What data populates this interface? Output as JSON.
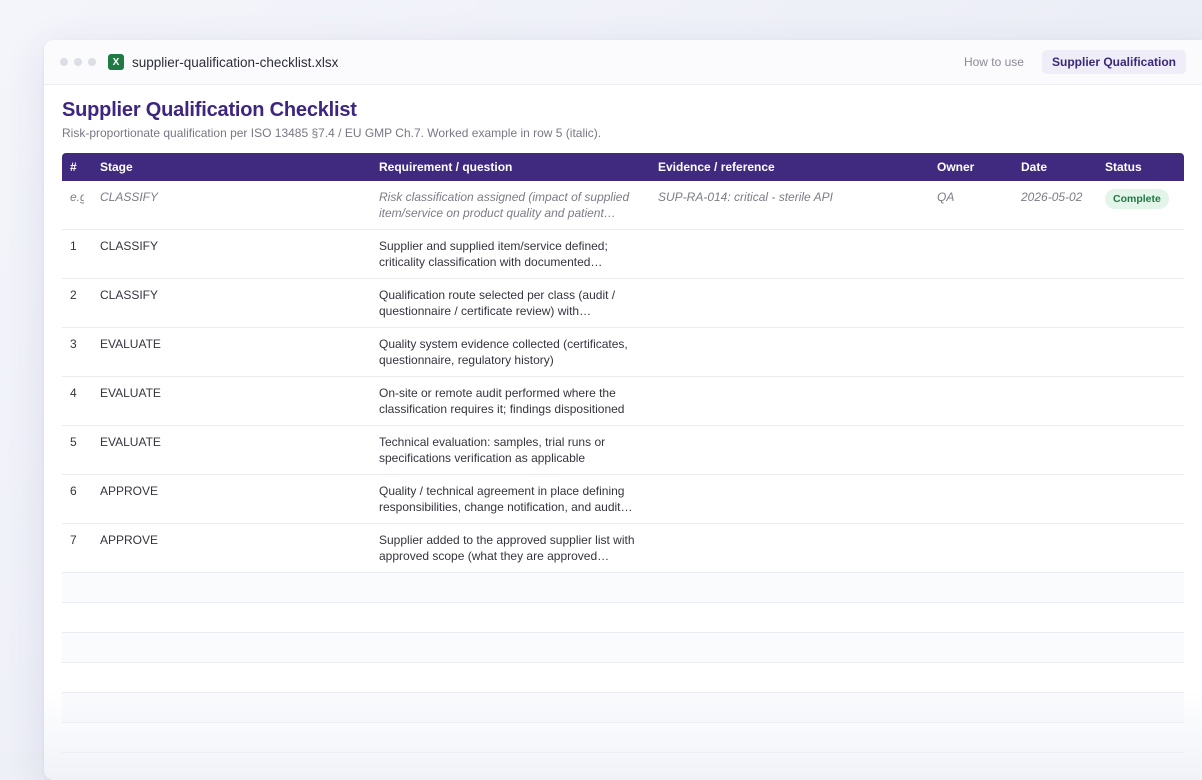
{
  "window": {
    "filename": "supplier-qualification-checklist.xlsx",
    "file_icon_letter": "X",
    "tabs": [
      {
        "label": "How to use",
        "active": false
      },
      {
        "label": "Supplier Qualification",
        "active": true
      }
    ]
  },
  "sheet": {
    "title": "Supplier Qualification Checklist",
    "subtitle": "Risk-proportionate qualification per ISO 13485 §7.4 / EU GMP Ch.7. Worked example in row 5 (italic).",
    "columns": [
      "#",
      "Stage",
      "Requirement / question",
      "Evidence / reference",
      "Owner",
      "Date",
      "Status"
    ],
    "example_row": {
      "num": "e.g.",
      "stage": "CLASSIFY",
      "requirement": "Risk classification assigned (impact of supplied item/service on product quality and patient…",
      "evidence": "SUP-RA-014: critical - sterile API",
      "owner": "QA",
      "date": "2026-05-02",
      "status": "Complete"
    },
    "rows": [
      {
        "num": "1",
        "stage": "CLASSIFY",
        "requirement": "Supplier and supplied item/service defined; criticality classification with documented…"
      },
      {
        "num": "2",
        "stage": "CLASSIFY",
        "requirement": "Qualification route selected per class (audit / questionnaire / certificate review) with…"
      },
      {
        "num": "3",
        "stage": "EVALUATE",
        "requirement": "Quality system evidence collected (certificates, questionnaire, regulatory history)"
      },
      {
        "num": "4",
        "stage": "EVALUATE",
        "requirement": "On-site or remote audit performed where the classification requires it; findings dispositioned"
      },
      {
        "num": "5",
        "stage": "EVALUATE",
        "requirement": "Technical evaluation: samples, trial runs or specifications verification as applicable"
      },
      {
        "num": "6",
        "stage": "APPROVE",
        "requirement": "Quality / technical agreement in place defining responsibilities, change notification, and audit…"
      },
      {
        "num": "7",
        "stage": "APPROVE",
        "requirement": "Supplier added to the approved supplier list with approved scope (what they are approved…"
      }
    ]
  },
  "colors": {
    "header_bg": "#3f2a7f",
    "title": "#3d2580",
    "status_complete_bg": "#e3f4e8",
    "status_complete_fg": "#1f7a44",
    "excel_green": "#1f7a44"
  }
}
